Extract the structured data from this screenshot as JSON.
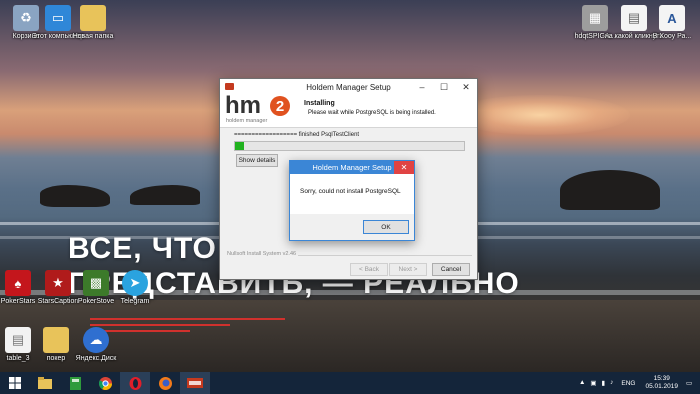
{
  "desktop": {
    "left_icons": [
      {
        "label": "Корзина",
        "icon": "recycle-bin-icon"
      },
      {
        "label": "Этот компьютер",
        "icon": "computer-icon"
      },
      {
        "label": "Новая папка",
        "icon": "folder-icon"
      }
    ],
    "right_icons": [
      {
        "label": "hdqtSPIGA...",
        "icon": "app-icon"
      },
      {
        "label": "на какой кликнуть",
        "icon": "document-icon"
      },
      {
        "label": "В Хооу Ра...",
        "icon": "word-document-icon"
      }
    ],
    "middle_icons": [
      {
        "label": "PokerStars",
        "icon": "pokerstars-icon"
      },
      {
        "label": "StarsCaption",
        "icon": "starscaption-icon"
      },
      {
        "label": "PokerStove",
        "icon": "pokerstove-icon"
      },
      {
        "label": "Telegram",
        "icon": "telegram-icon"
      }
    ],
    "bottom_icons": [
      {
        "label": "table_3",
        "icon": "file-icon"
      },
      {
        "label": "покер",
        "icon": "folder-icon"
      },
      {
        "label": "Яндекс.Диск",
        "icon": "yandex-disk-icon"
      }
    ],
    "wallpaper_text_line1": "ВСЕ, ЧТО ... ...",
    "wallpaper_text_line2": "ПРЕДСТАВИТЬ, — РЕАЛЬНО"
  },
  "setup": {
    "title": "Holdem Manager Setup",
    "logo_text": "hm",
    "logo_number": "2",
    "logo_sub": "holdem manager",
    "header_title": "Installing",
    "header_subtitle": "Please wait while PostgreSQL is being installed.",
    "status_text": "================== finished PsqlTestClient",
    "progress": 0.04,
    "show_details_label": "Show details",
    "footer_label": "Nullsoft Install System v2.46",
    "back_label": "< Back",
    "next_label": "Next >",
    "cancel_label": "Cancel"
  },
  "error_dialog": {
    "title": "Holdem Manager Setup",
    "message": "Sorry, could not install PostgreSQL",
    "ok_label": "OK"
  },
  "taskbar": {
    "items": [
      "windows-start-icon",
      "file-explorer-icon",
      "calculator-icon",
      "chrome-icon",
      "opera-icon",
      "firefox-icon",
      "holdem-manager-icon"
    ],
    "language": "ENG",
    "time": "15:39",
    "date": "05.01.2019"
  },
  "colors": {
    "accent_red": "#c43a1f",
    "dialog_blue": "#3b86d6",
    "progress_green": "#21b21f",
    "taskbar": "#14253a"
  }
}
